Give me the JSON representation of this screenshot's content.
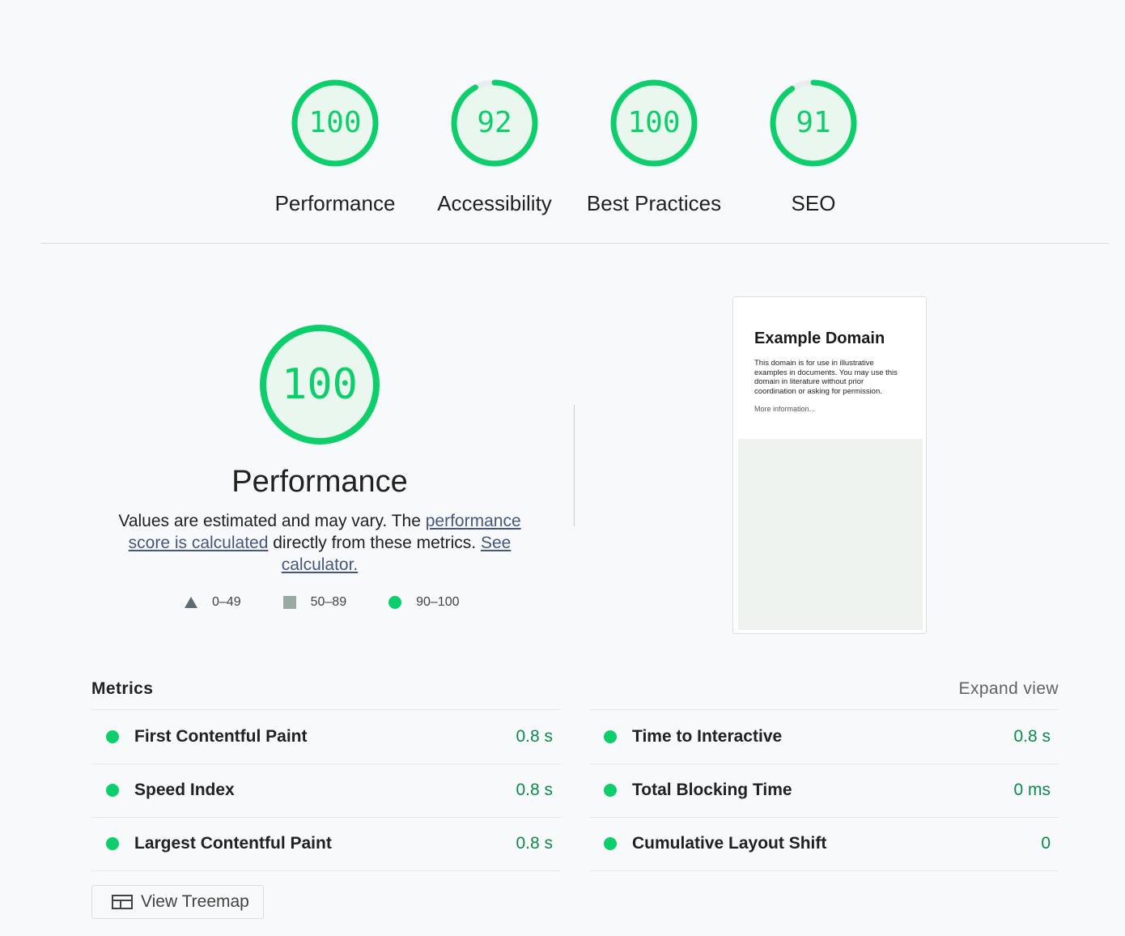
{
  "colors": {
    "pass": "#0cce6b",
    "text": "#212121",
    "link": "#47577c"
  },
  "gauges": [
    {
      "score": "100",
      "label": "Performance",
      "value": 100
    },
    {
      "score": "92",
      "label": "Accessibility",
      "value": 92
    },
    {
      "score": "100",
      "label": "Best Practices",
      "value": 100
    },
    {
      "score": "91",
      "label": "SEO",
      "value": 91
    }
  ],
  "performance": {
    "score": "100",
    "title": "Performance",
    "desc_prefix": "Values are estimated and may vary. The ",
    "desc_link1": "performance score is calculated",
    "desc_middle": " directly from these metrics. ",
    "desc_link2": "See calculator."
  },
  "legend": {
    "fail": "0–49",
    "average": "50–89",
    "pass": "90–100"
  },
  "thumbnail": {
    "title": "Example Domain",
    "text": "This domain is for use in illustrative examples in documents. You may use this domain in literature without prior coordination or asking for permission.",
    "link": "More information..."
  },
  "metrics": {
    "title": "Metrics",
    "expand_label": "Expand view",
    "left": [
      {
        "name": "First Contentful Paint",
        "value": "0.8 s"
      },
      {
        "name": "Speed Index",
        "value": "0.8 s"
      },
      {
        "name": "Largest Contentful Paint",
        "value": "0.8 s"
      }
    ],
    "right": [
      {
        "name": "Time to Interactive",
        "value": "0.8 s"
      },
      {
        "name": "Total Blocking Time",
        "value": "0 ms"
      },
      {
        "name": "Cumulative Layout Shift",
        "value": "0"
      }
    ]
  },
  "treemap": {
    "label": "View Treemap",
    "icon": "treemap-icon"
  }
}
